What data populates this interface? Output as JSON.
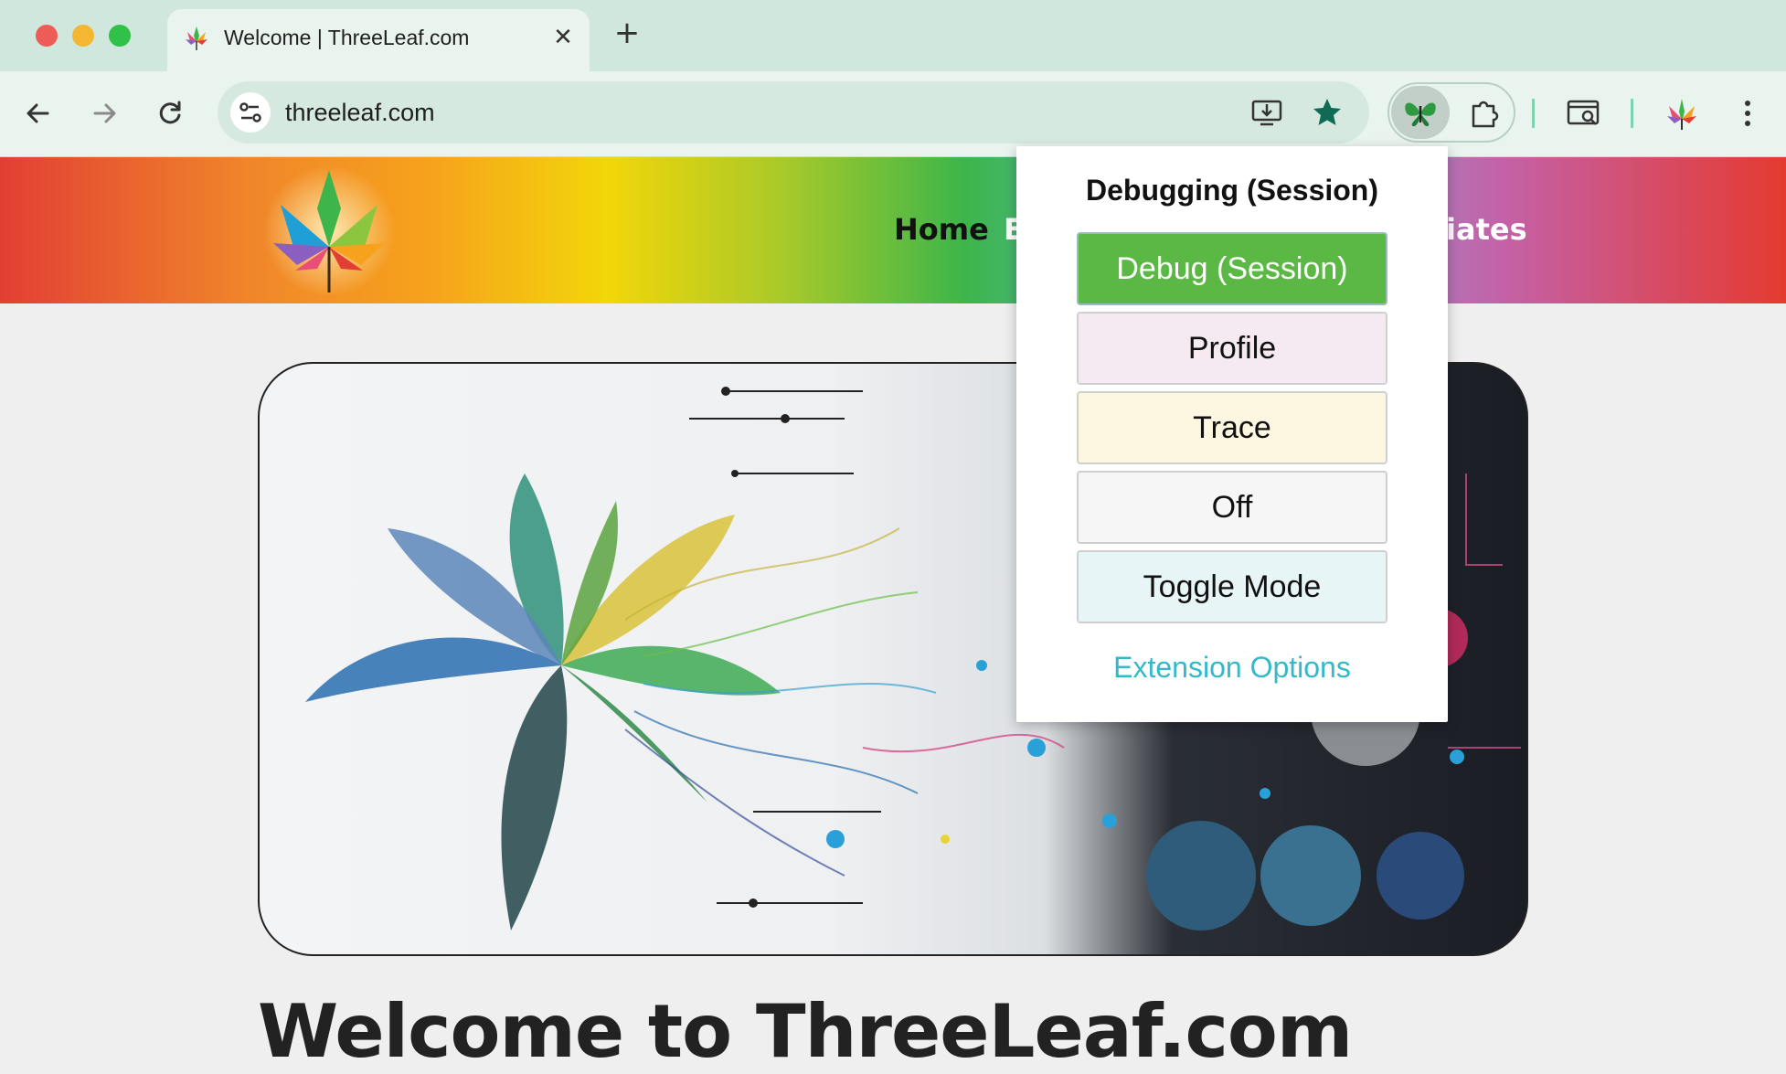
{
  "browser": {
    "tab_title": "Welcome | ThreeLeaf.com",
    "tab_close": "✕",
    "new_tab": "+",
    "url": "threeleaf.com"
  },
  "site": {
    "nav": {
      "home": "Home",
      "partial_left": "E",
      "partial_right": "iates"
    },
    "welcome_heading": "Welcome to ThreeLeaf.com"
  },
  "popup": {
    "title": "Debugging (Session)",
    "buttons": [
      "Debug (Session)",
      "Profile",
      "Trace",
      "Off",
      "Toggle Mode"
    ],
    "options_link": "Extension Options"
  },
  "colors": {
    "traffic_close": "#ee5d55",
    "traffic_min": "#f4b731",
    "traffic_max": "#31c048",
    "debug_active": "#5cb844",
    "link": "#35b8c9"
  }
}
